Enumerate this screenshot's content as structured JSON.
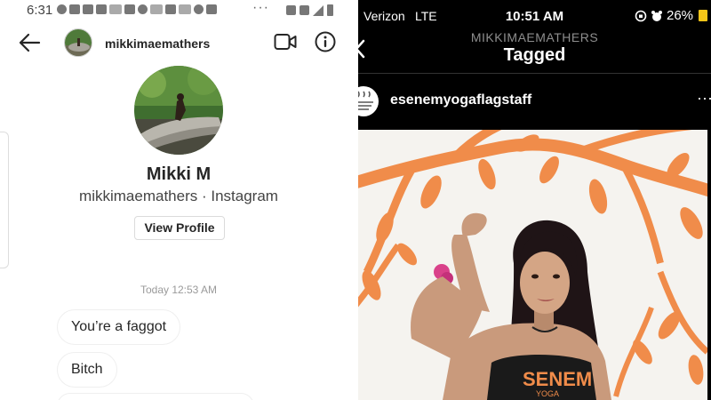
{
  "left": {
    "status_bar": {
      "time": "6:31",
      "overflow": "···"
    },
    "header": {
      "username": "mikkimaemathers",
      "icons": {
        "back": "arrow-left-icon",
        "video": "video-call-icon",
        "info": "info-icon"
      }
    },
    "profile": {
      "name": "Mikki M",
      "subtitle": "mikkimaemathers · Instagram",
      "view_profile_label": "View Profile"
    },
    "thread": {
      "timestamp": "Today 12:53 AM",
      "messages": [
        {
          "text": "You’re a faggot"
        },
        {
          "text": "Bitch"
        }
      ]
    }
  },
  "right": {
    "status_bar": {
      "carrier": "Verizon",
      "network": "LTE",
      "time": "10:51 AM",
      "battery_pct": "26%"
    },
    "nav": {
      "subtitle": "MIKKIMAEMATHERS",
      "title": "Tagged"
    },
    "post": {
      "username": "esenemyogaflagstaff",
      "more": "···",
      "shirt_text": "SENEM",
      "shirt_sub": "YOGA"
    }
  },
  "colors": {
    "instagram_text": "#262626",
    "muted": "#9a9a9a",
    "mural_orange": "#f08c4a",
    "battery_yellow": "#f5c518"
  }
}
